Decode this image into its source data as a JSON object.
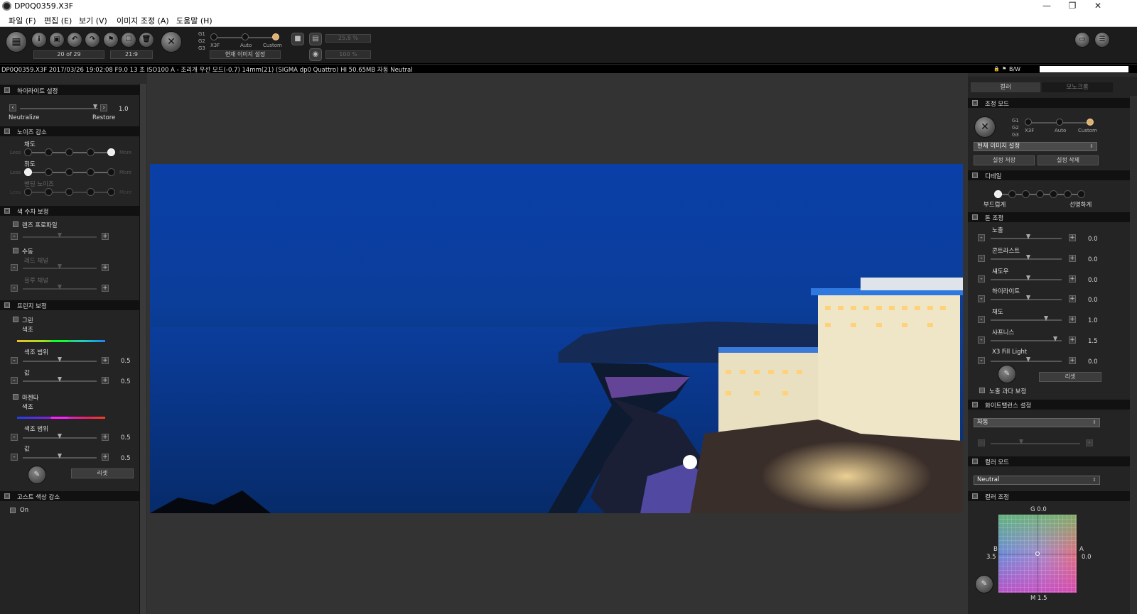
{
  "window": {
    "title": "DP0Q0359.X3F",
    "minimize": "—",
    "restore": "❐",
    "close": "✕"
  },
  "menu": {
    "items": [
      "파일 (F)",
      "편집 (E)",
      "보기 (V)",
      "이미지 조정 (A)",
      "도움말 (H)"
    ]
  },
  "toolbar": {
    "logo_glyph": "▦",
    "buttons": [
      "i",
      "▣",
      "↶",
      "↷",
      "⚑",
      "☐",
      "🗑"
    ],
    "mode_glyph": "✕",
    "g_labels": [
      "G1",
      "G2",
      "G3"
    ],
    "mode_labels": [
      "X3F",
      "Auto",
      "Custom"
    ],
    "preset_select": "현재 이미지 설정",
    "counter": "20 of 29",
    "ratio": "21:9",
    "zoom_fit": "25.8 %",
    "zoom_full": "100 %"
  },
  "infobar": {
    "text": "DP0Q0359.X3F 2017/03/26 19:02:08 F9.0 13 초 ISO100 A - 조리개 우선 모드(-0.7) 14mm(21) (SIGMA dp0 Quattro) HI 50.65MB 자동 Neutral",
    "bw_label": "B/W"
  },
  "left": {
    "highlight": {
      "title": "하이라이트 설정",
      "neutralize": "Neutralize",
      "restore": "Restore",
      "value": "1.0"
    },
    "noise": {
      "title": "노이즈 감소",
      "chroma": "채도",
      "luma": "휘도",
      "banding": "밴딩 노이즈",
      "less": "Less",
      "more": "More"
    },
    "aberration": {
      "title": "색 수차 보정",
      "lens_profile": "렌즈 프로파일",
      "manual": "수동",
      "red_channel": "레드 채널",
      "blue_channel": "블루 채널"
    },
    "fringe": {
      "title": "프린지 보정",
      "green": "그린",
      "hue": "색조",
      "hue_range": "색조 범위",
      "amount": "값",
      "magenta": "마젠타",
      "green_range_val": "0.5",
      "green_amount_val": "0.5",
      "magenta_range_val": "0.5",
      "magenta_amount_val": "0.5",
      "reset": "리셋"
    },
    "ghost": {
      "title": "고스트 색상 감소",
      "on": "On"
    }
  },
  "right": {
    "tabs": [
      "컬러",
      "모노크롬"
    ],
    "adjust_mode": {
      "title": "조정 모드",
      "g_labels": [
        "G1",
        "G2",
        "G3"
      ],
      "mode_labels": [
        "X3F",
        "Auto",
        "Custom"
      ],
      "preset": "현재 이미지 설정",
      "save": "설정 저장",
      "delete": "설정 삭제"
    },
    "detail": {
      "title": "디테일",
      "soft": "부드럽게",
      "sharp": "선명하게"
    },
    "tone": {
      "title": "톤 조정",
      "rows": [
        {
          "label": "노출",
          "value": "0.0"
        },
        {
          "label": "콘트라스트",
          "value": "0.0"
        },
        {
          "label": "섀도우",
          "value": "0.0"
        },
        {
          "label": "하이라이트",
          "value": "0.0"
        },
        {
          "label": "채도",
          "value": "1.0"
        },
        {
          "label": "샤프니스",
          "value": "1.5"
        },
        {
          "label": "X3 Fill Light",
          "value": "0.0"
        }
      ],
      "reset": "리셋",
      "overexposure": "노출 과다 보정"
    },
    "white_balance": {
      "title": "화이트밸런스 설정",
      "value": "자동"
    },
    "color_mode": {
      "title": "컬러 모드",
      "value": "Neutral"
    },
    "color_adjust": {
      "title": "컬러 조정",
      "g": "G 0.0",
      "b_label": "B",
      "b_value": "3.5",
      "a_label": "A",
      "a_value": "0.0",
      "m": "M 1.5"
    }
  }
}
